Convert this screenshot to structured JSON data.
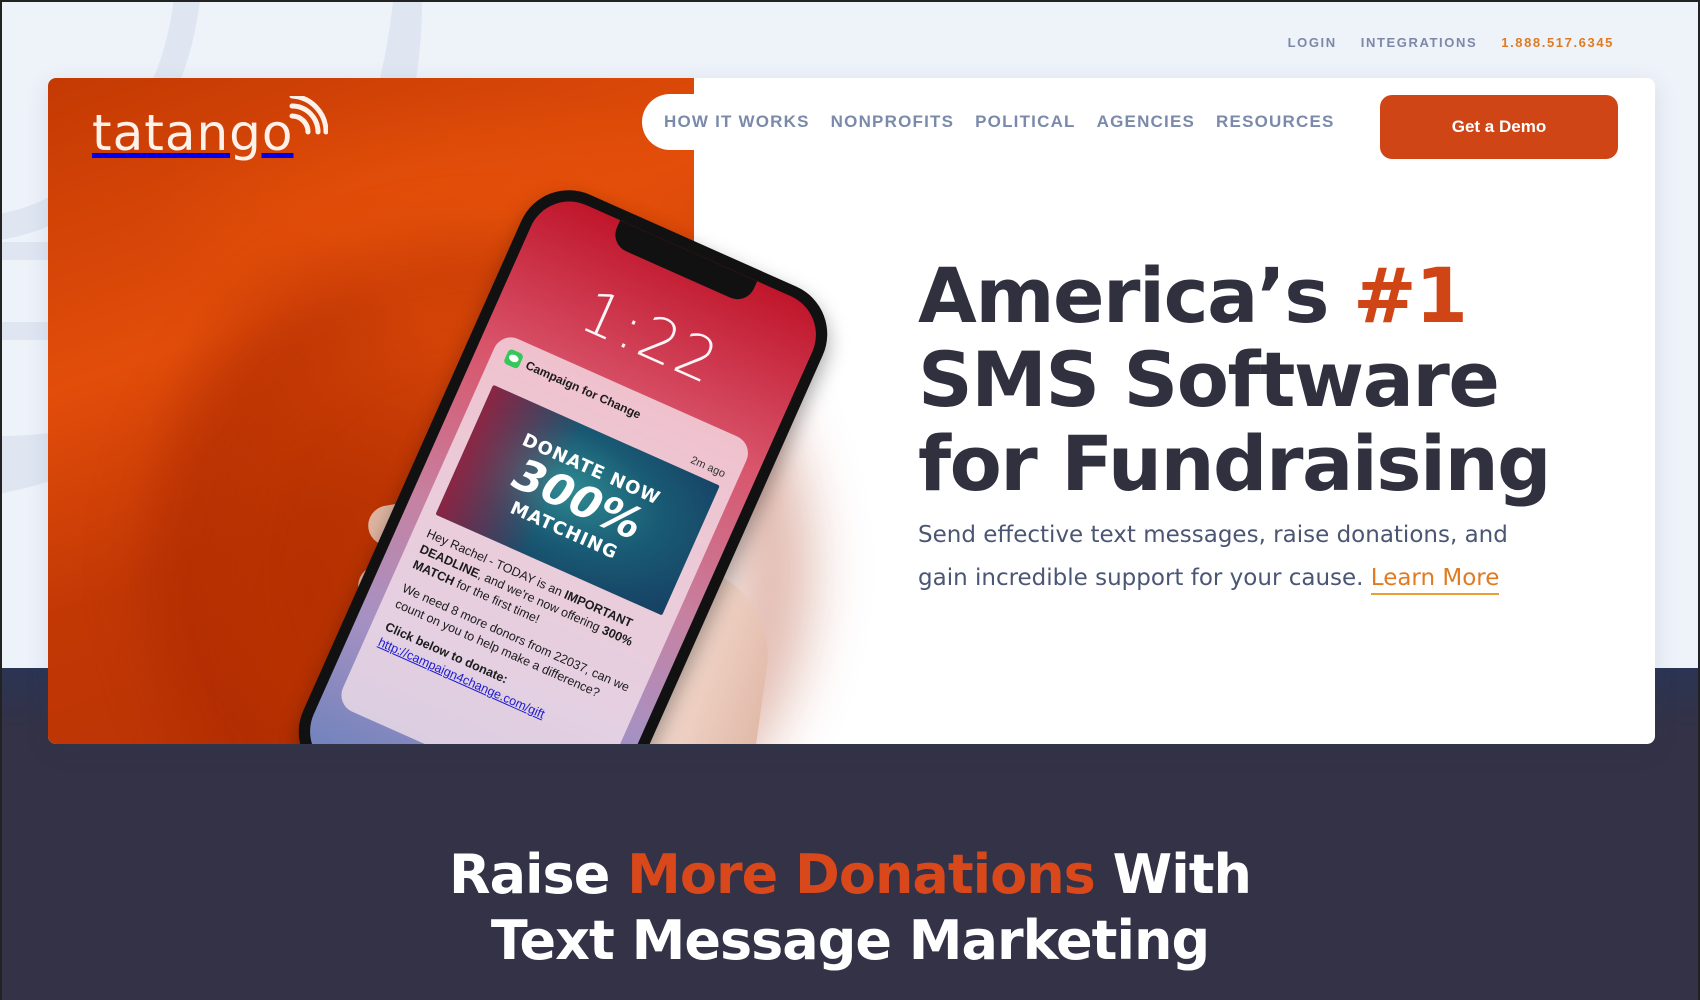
{
  "utility_nav": {
    "login": "LOGIN",
    "integrations": "INTEGRATIONS",
    "phone": "1.888.517.6345"
  },
  "brand": {
    "logo_text": "tatango",
    "logo_icon": "signal-waves-icon",
    "colors": {
      "primary_orange": "#d04515",
      "phone_orange": "#e07b22",
      "navy_text": "#30303f",
      "nav_gray": "#7b8aaa",
      "dark_band": "#333246"
    }
  },
  "main_nav": {
    "items": [
      {
        "label": "HOW IT WORKS"
      },
      {
        "label": "NONPROFITS"
      },
      {
        "label": "POLITICAL"
      },
      {
        "label": "AGENCIES"
      },
      {
        "label": "RESOURCES"
      }
    ],
    "cta_label": "Get a Demo"
  },
  "hero": {
    "headline_part1": "America’s ",
    "headline_accent": "#1",
    "headline_line2": "SMS Software",
    "headline_line3": "for Fundraising",
    "subhead": "Send effective text messages, raise donations, and gain incredible support for your cause.",
    "learn_more": "Learn More"
  },
  "phone_mockup": {
    "clock": "1:22",
    "notification": {
      "app_icon": "messages-icon",
      "sender": "Campaign for Change",
      "time": "2m ago",
      "promo_line1": "DONATE NOW",
      "promo_line2": "300%",
      "promo_line3": "MATCHING",
      "msg_greeting": "Hey Rachel - TODAY is an ",
      "msg_bold1": "IMPORTANT DEADLINE",
      "msg_mid": ", and we're now offering ",
      "msg_bold2": "300% MATCH",
      "msg_end": " for the first time!",
      "msg_para2": "We need 8 more donors from 22037, can we count on you to help make a difference?",
      "msg_cta": "Click below to donate:",
      "msg_link": "http://campaign4change.com/gift"
    }
  },
  "section": {
    "title_part1": "Raise ",
    "title_accent": "More Donations",
    "title_part2": " With",
    "title_line2": "Text Message Marketing"
  }
}
